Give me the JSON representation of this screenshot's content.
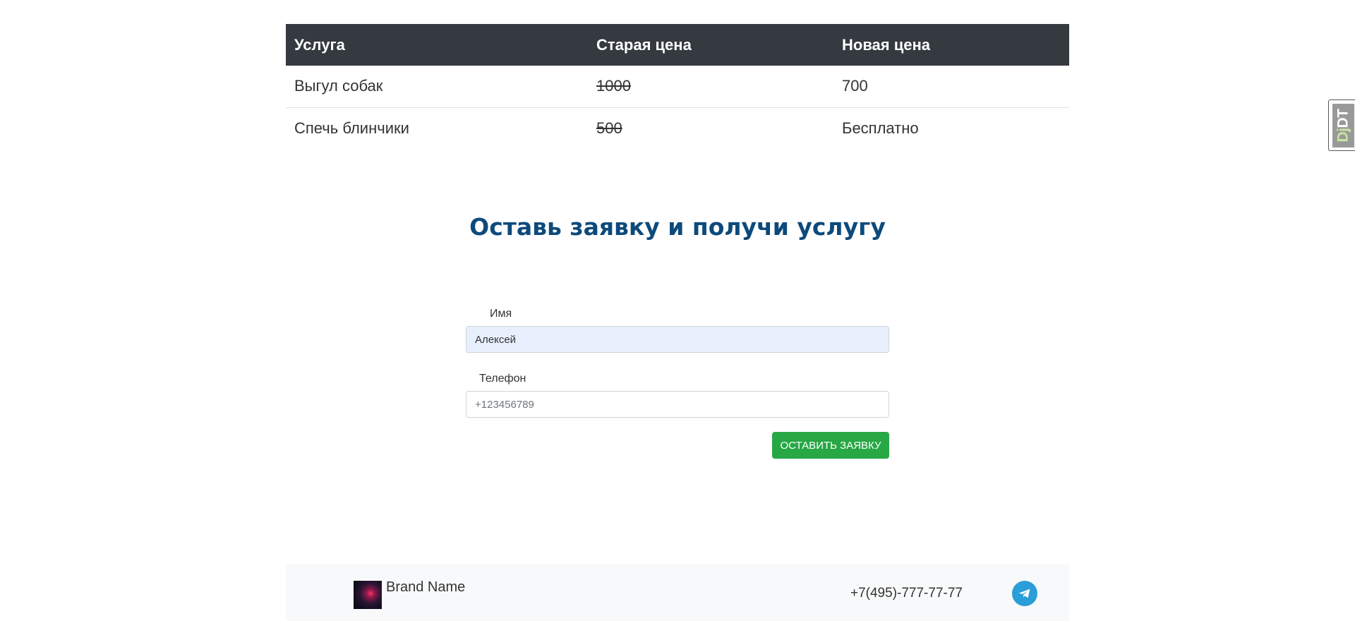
{
  "table": {
    "headers": [
      "Услуга",
      "Старая цена",
      "Новая цена"
    ],
    "rows": [
      {
        "service": "Выгул собак",
        "old_price": "1000",
        "new_price": "700"
      },
      {
        "service": "Спечь блинчики",
        "old_price": "500",
        "new_price": "Бесплатно"
      }
    ]
  },
  "section": {
    "title": "Оставь заявку и получи услугу"
  },
  "form": {
    "name_label": "Имя",
    "name_value": "Алексей",
    "phone_label": "Телефон",
    "phone_placeholder": "+123456789",
    "submit_label": "ОСТАВИТЬ ЗАЯВКУ"
  },
  "footer": {
    "brand_name": "Brand Name",
    "phone": "+7(495)-777-77-77",
    "telegram_icon": "telegram-icon"
  },
  "djdt": {
    "label_dj": "Dj",
    "label_dt": "DT"
  },
  "colors": {
    "table_header_bg": "#343a40",
    "title": "#0d4a7c",
    "submit": "#28a745",
    "telegram": "#2a9ed8",
    "autofill_bg": "#e8f0fe"
  }
}
